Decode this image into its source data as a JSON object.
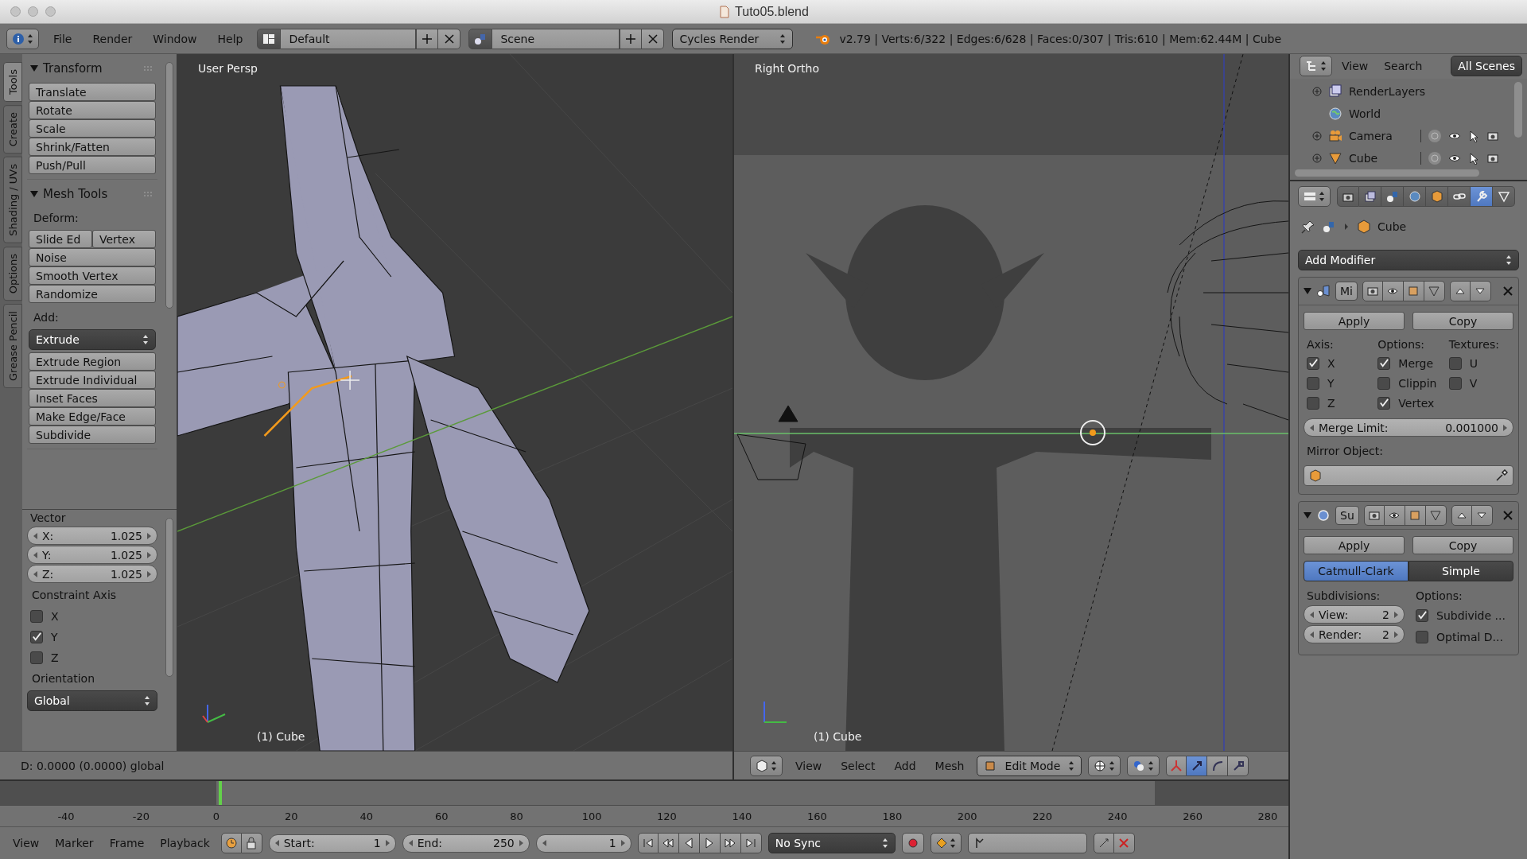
{
  "window": {
    "title": "Tuto05.blend"
  },
  "info_header": {
    "menus": [
      "File",
      "Render",
      "Window",
      "Help"
    ],
    "layout": "Default",
    "scene": "Scene",
    "render_engine": "Cycles Render",
    "stats": "v2.79 | Verts:6/322 | Edges:6/628 | Faces:0/307 | Tris:610 | Mem:62.44M | Cube"
  },
  "tool_shelf": {
    "tabs": [
      {
        "label": "Tools",
        "selected": true
      },
      {
        "label": "Create",
        "selected": false
      },
      {
        "label": "Shading / UVs",
        "selected": false
      },
      {
        "label": "Options",
        "selected": false
      },
      {
        "label": "Grease Pencil",
        "selected": false
      }
    ],
    "panels": [
      {
        "title": "Transform",
        "groups": [
          {
            "rows": [
              [
                "Translate"
              ],
              [
                "Rotate"
              ],
              [
                "Scale"
              ],
              [
                "Shrink/Fatten"
              ],
              [
                "Push/Pull"
              ]
            ]
          }
        ]
      },
      {
        "title": "Mesh Tools",
        "groups": [
          {
            "label": "Deform:",
            "rows": [
              [
                "Slide Ed",
                "Vertex"
              ],
              [
                "Noise"
              ],
              [
                "Smooth Vertex"
              ],
              [
                "Randomize"
              ]
            ]
          },
          {
            "label": "Add:",
            "dropdown": "Extrude",
            "rows": [
              [
                "Extrude Region"
              ],
              [
                "Extrude Individual"
              ],
              [
                "Inset Faces"
              ],
              [
                "Make Edge/Face"
              ],
              [
                "Subdivide"
              ]
            ]
          }
        ]
      }
    ]
  },
  "operator_panel": {
    "title": "Vector",
    "fields": [
      {
        "label": "X:",
        "value": "1.025"
      },
      {
        "label": "Y:",
        "value": "1.025"
      },
      {
        "label": "Z:",
        "value": "1.025"
      }
    ],
    "constraint_label": "Constraint Axis",
    "axes": [
      {
        "label": "X",
        "checked": false
      },
      {
        "label": "Y",
        "checked": true
      },
      {
        "label": "Z",
        "checked": false
      }
    ],
    "orientation_label": "Orientation",
    "orientation": "Global"
  },
  "left_viewport": {
    "view_name": "User Persp",
    "object_label": "(1) Cube",
    "header_text": "D: 0.0000 (0.0000) global"
  },
  "right_viewport": {
    "view_name": "Right Ortho",
    "object_label": "(1) Cube",
    "menus": [
      "View",
      "Select",
      "Add",
      "Mesh"
    ],
    "mode": "Edit Mode",
    "manipulators": [
      {
        "selected": false
      },
      {
        "selected": true
      },
      {
        "selected": false
      },
      {
        "selected": false
      }
    ]
  },
  "outliner": {
    "menus": [
      "View",
      "Search"
    ],
    "display": "All Scenes",
    "items": [
      {
        "label": "RenderLayers",
        "kind": "renderlayers",
        "collapsed": true
      },
      {
        "label": "World",
        "kind": "world",
        "collapsed": false
      },
      {
        "label": "Camera",
        "kind": "camera",
        "collapsed": true
      },
      {
        "label": "Cube",
        "kind": "mesh",
        "collapsed": true
      }
    ]
  },
  "properties": {
    "tabs": [
      {
        "kind": "render",
        "selected": false
      },
      {
        "kind": "layers",
        "selected": false
      },
      {
        "kind": "scene",
        "selected": false
      },
      {
        "kind": "world",
        "selected": false
      },
      {
        "kind": "object",
        "selected": false
      },
      {
        "kind": "constraints",
        "selected": false
      },
      {
        "kind": "modifiers",
        "selected": true
      },
      {
        "kind": "data",
        "selected": false
      }
    ],
    "context": "Cube",
    "add_modifier": "Add Modifier",
    "modifiers": [
      {
        "kind": "mirror",
        "name": "Mi",
        "apply": "Apply",
        "copy": "Copy",
        "columns": [
          {
            "heading": "Axis:",
            "options": [
              {
                "label": "X",
                "checked": true
              },
              {
                "label": "Y",
                "checked": false
              },
              {
                "label": "Z",
                "checked": false
              }
            ]
          },
          {
            "heading": "Options:",
            "options": [
              {
                "label": "Merge",
                "checked": true
              },
              {
                "label": "Clippin",
                "checked": false
              },
              {
                "label": "Vertex",
                "checked": true
              }
            ]
          },
          {
            "heading": "Textures:",
            "options": [
              {
                "label": "U",
                "checked": false
              },
              {
                "label": "V",
                "checked": false
              }
            ]
          }
        ],
        "merge_limit": {
          "label": "Merge Limit:",
          "value": "0.001000"
        },
        "mirror_object_label": "Mirror Object:"
      },
      {
        "kind": "subsurf",
        "name": "Su",
        "apply": "Apply",
        "copy": "Copy",
        "algorithms": [
          {
            "label": "Catmull-Clark",
            "selected": true
          },
          {
            "label": "Simple",
            "selected": false
          }
        ],
        "subdivisions_label": "Subdivisions:",
        "levels": [
          {
            "label": "View:",
            "value": "2"
          },
          {
            "label": "Render:",
            "value": "2"
          }
        ],
        "options_label": "Options:",
        "options": [
          {
            "label": "Subdivide ...",
            "checked": true
          },
          {
            "label": "Optimal D...",
            "checked": false
          }
        ]
      }
    ]
  },
  "timeline": {
    "ticks": [
      "-40",
      "-20",
      "0",
      "20",
      "40",
      "60",
      "80",
      "100",
      "120",
      "140",
      "160",
      "180",
      "200",
      "220",
      "240",
      "260",
      "280"
    ],
    "menus": [
      "View",
      "Marker",
      "Frame",
      "Playback"
    ],
    "start": {
      "label": "Start:",
      "value": "1"
    },
    "end": {
      "label": "End:",
      "value": "250"
    },
    "current": "1",
    "sync": "No Sync"
  }
}
